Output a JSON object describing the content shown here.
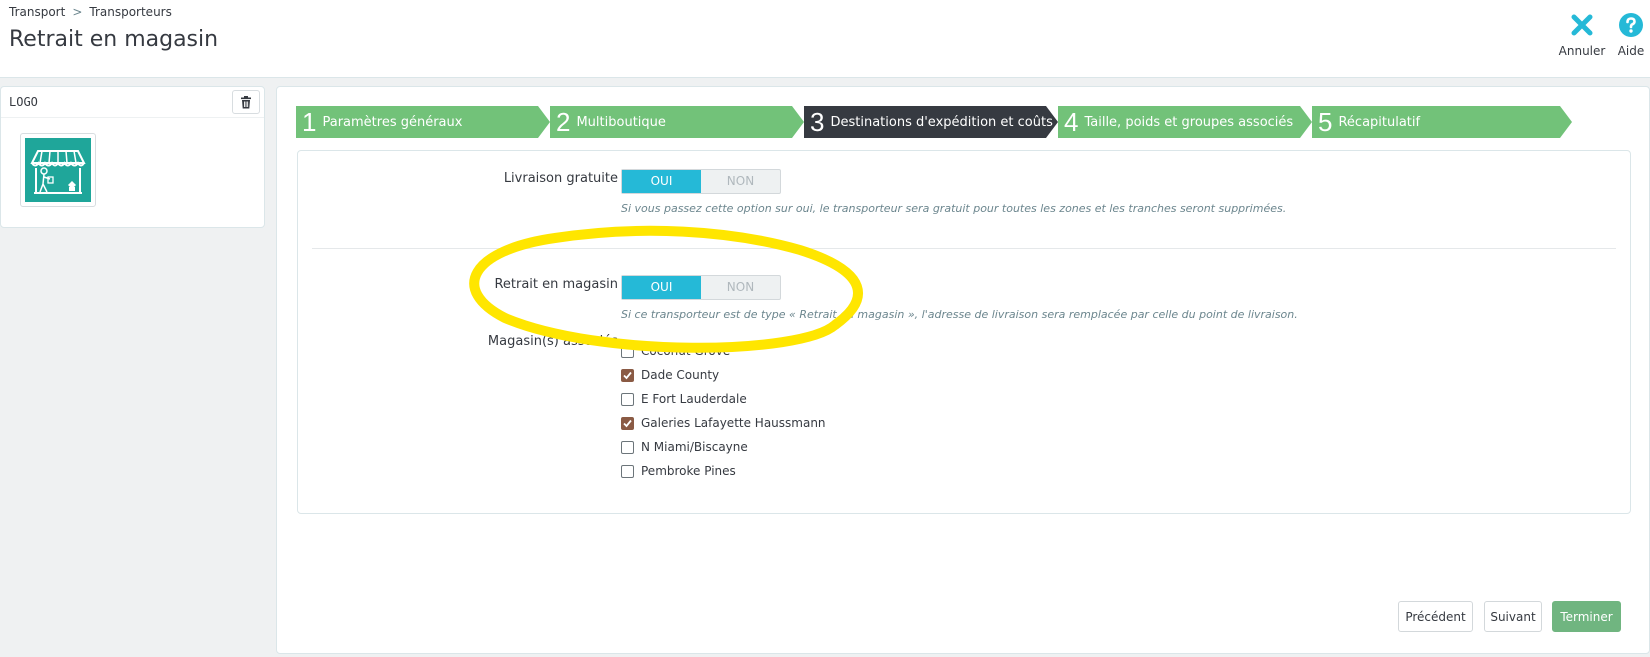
{
  "breadcrumb": {
    "item1": "Transport",
    "separator": ">",
    "item2": "Transporteurs"
  },
  "page_title": "Retrait en magasin",
  "toolbar": {
    "cancel_label": "Annuler",
    "help_label": "Aide",
    "cancel_icon": "close-icon",
    "help_icon": "question-icon"
  },
  "logo_panel": {
    "title": "LOGO",
    "delete_icon": "trash-icon",
    "image": "store-front-logo"
  },
  "steps": [
    {
      "num": "1",
      "label": "Paramètres généraux",
      "active": false
    },
    {
      "num": "2",
      "label": "Multiboutique",
      "active": false
    },
    {
      "num": "3",
      "label": "Destinations d'expédition et coûts",
      "active": true
    },
    {
      "num": "4",
      "label": "Taille, poids et groupes associés",
      "active": false
    },
    {
      "num": "5",
      "label": "Récapitulatif",
      "active": false
    }
  ],
  "form": {
    "free_shipping": {
      "label": "Livraison gratuite",
      "yes": "OUI",
      "no": "NON",
      "value": "OUI",
      "help": "Si vous passez cette option sur oui, le transporteur sera gratuit pour toutes les zones et les tranches seront supprimées."
    },
    "pickup": {
      "label": "Retrait en magasin",
      "yes": "OUI",
      "no": "NON",
      "value": "OUI",
      "help": "Si ce transporteur est de type « Retrait en magasin », l'adresse de livraison sera remplacée par celle du point de livraison."
    },
    "stores_label": "Magasin(s) associés",
    "stores": [
      {
        "name": "Coconut Grove",
        "checked": false
      },
      {
        "name": "Dade County",
        "checked": true
      },
      {
        "name": "E Fort Lauderdale",
        "checked": false
      },
      {
        "name": "Galeries Lafayette Haussmann",
        "checked": true
      },
      {
        "name": "N Miami/Biscayne",
        "checked": false
      },
      {
        "name": "Pembroke Pines",
        "checked": false
      }
    ]
  },
  "footer": {
    "prev_label": "Précédent",
    "next_label": "Suivant",
    "finish_label": "Terminer"
  },
  "colors": {
    "step_green": "#72c279",
    "step_active": "#363a41",
    "switch_on": "#25b9d7",
    "finish_green": "#70b580",
    "annotation": "#ffe600",
    "logo_bg": "#1fa69a"
  }
}
